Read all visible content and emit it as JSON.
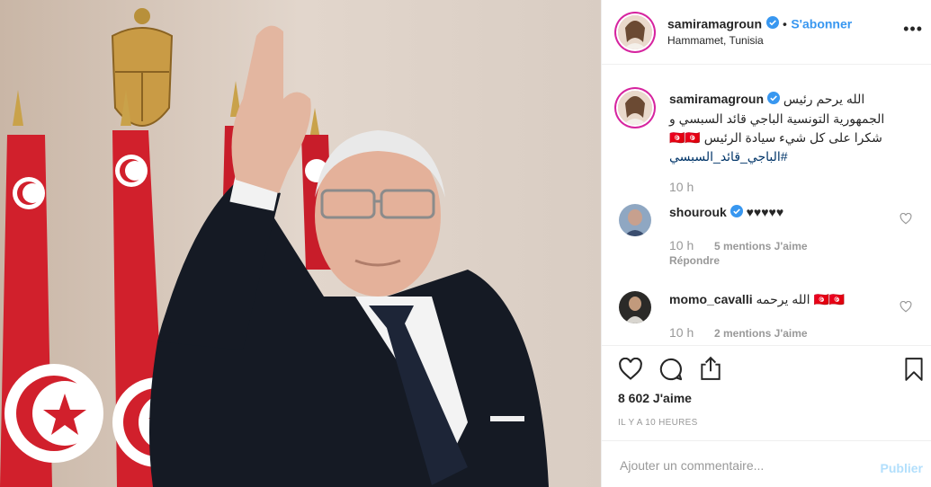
{
  "post": {
    "username": "samiramagroun",
    "follow_label": "S'abonner",
    "location": "Hammamet, Tunisia",
    "caption": "الله يرحم رئيس الجمهورية التونسية الباجي قائد السبسي و شكرا على كل شيء سيادة الرئيس 🇹🇳🇹🇳",
    "hashtag": "#الباجي_قائد_السبسي",
    "caption_time": "10 h",
    "likes": "8 602 J'aime",
    "posted_ago": "IL Y A 10 HEURES"
  },
  "comments": [
    {
      "username": "shourouk",
      "verified": true,
      "text": "♥♥♥♥♥",
      "time": "10 h",
      "likes": "5 mentions J'aime",
      "reply": "Répondre"
    },
    {
      "username": "momo_cavalli",
      "verified": false,
      "text": "الله يرحمه 🇹🇳🇹🇳",
      "time": "10 h",
      "likes": "2 mentions J'aime"
    }
  ],
  "add_comment": {
    "placeholder": "Ajouter un commentaire...",
    "publish_label": "Publier"
  },
  "colors": {
    "link": "#3897f0",
    "verified": "#3897f0",
    "muted": "#999999",
    "publish_disabled": "#b2dffc"
  },
  "icons": [
    "verified-badge-icon",
    "more-options-icon",
    "heart-icon",
    "comment-icon",
    "share-icon",
    "bookmark-icon"
  ]
}
